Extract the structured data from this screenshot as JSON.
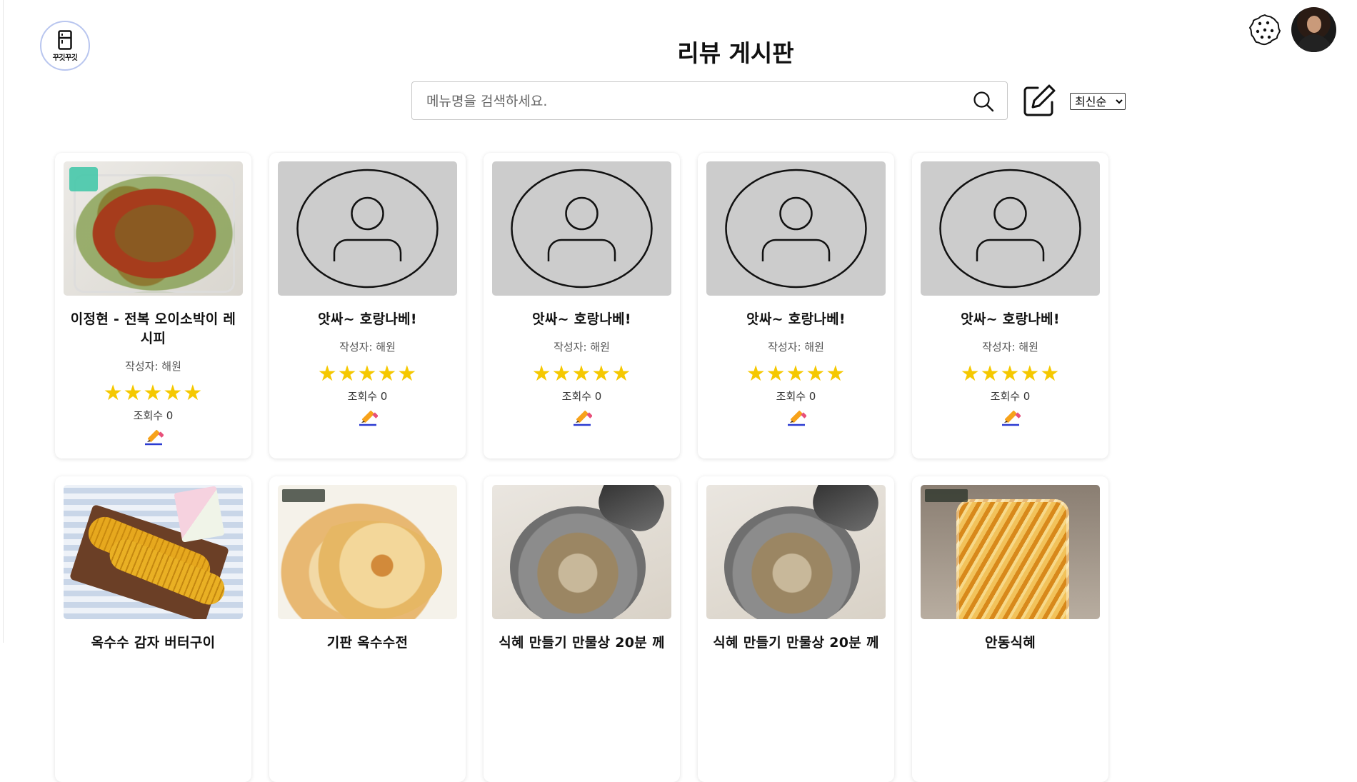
{
  "header": {
    "title": "리뷰 게시판",
    "logo_text": "꾸깃꾸깃",
    "search_placeholder": "메뉴명을 검색하세요.",
    "sort": {
      "selected": "최신순",
      "options": [
        "최신순"
      ]
    }
  },
  "icons": {
    "search": "search-icon",
    "write": "write-icon",
    "cookie": "cookie-icon",
    "edit": "pencil-icon"
  },
  "colors": {
    "star": "#f5c800",
    "placeholder_bg": "#cccccc"
  },
  "cards": [
    {
      "title": "이정현 - 전복 오이소박이 레시피",
      "author": "작성자: 해원",
      "rating": 5,
      "stars": "★★★★★",
      "views": "조회수 0"
    },
    {
      "title": "앗싸~ 호랑나베!",
      "author": "작성자: 해원",
      "rating": 5,
      "stars": "★★★★★",
      "views": "조회수 0"
    },
    {
      "title": "앗싸~ 호랑나베!",
      "author": "작성자: 해원",
      "rating": 5,
      "stars": "★★★★★",
      "views": "조회수 0"
    },
    {
      "title": "앗싸~ 호랑나베!",
      "author": "작성자: 해원",
      "rating": 5,
      "stars": "★★★★★",
      "views": "조회수 0"
    },
    {
      "title": "앗싸~ 호랑나베!",
      "author": "작성자: 해원",
      "rating": 5,
      "stars": "★★★★★",
      "views": "조회수 0"
    },
    {
      "title": "옥수수 감자 버터구이",
      "author": "",
      "stars": "",
      "views": ""
    },
    {
      "title": "기판 옥수수전",
      "author": "",
      "stars": "",
      "views": ""
    },
    {
      "title": "식혜 만들기 만물상 20분 께",
      "author": "",
      "stars": "",
      "views": ""
    },
    {
      "title": "식혜 만들기 만물상 20분 께",
      "author": "",
      "stars": "",
      "views": ""
    },
    {
      "title": "안동식혜",
      "author": "",
      "stars": "",
      "views": ""
    }
  ]
}
